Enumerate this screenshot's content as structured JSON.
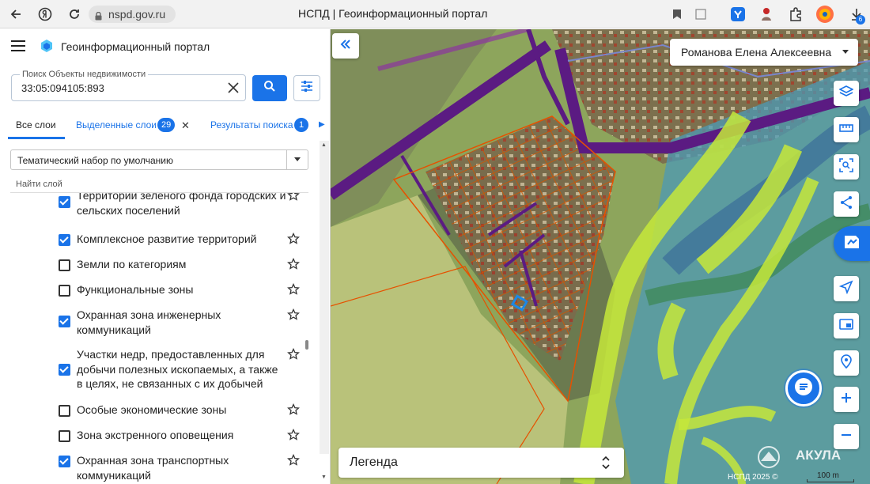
{
  "browser": {
    "url": "nspd.gov.ru",
    "page_title": "НСПД | Геоинформационный портал",
    "download_count": "6"
  },
  "app": {
    "title": "Геоинформационный портал"
  },
  "search": {
    "label": "Поиск Объекты недвижимости",
    "value": "33:05:094105:893"
  },
  "tabs": {
    "all": "Все слои",
    "selected": "Выделенные слои",
    "selected_count": "29",
    "results": "Результаты поиска",
    "results_count": "1"
  },
  "theme_select": {
    "value": "Тематический набор по умолчанию"
  },
  "find_layer": {
    "placeholder": "Найти слой"
  },
  "layers": [
    {
      "label": "Территории зеленого фонда городских и сельских поселений",
      "checked": true
    },
    {
      "label": "Комплексное развитие территорий",
      "checked": true
    },
    {
      "label": "Земли по категориям",
      "checked": false
    },
    {
      "label": "Функциональные зоны",
      "checked": false
    },
    {
      "label": "Охранная зона инженерных коммуникаций",
      "checked": true
    },
    {
      "label": "Участки недр, предоставленных для добычи полезных ископаемых, а также в целях, не связанных с их добычей",
      "checked": true
    },
    {
      "label": "Особые экономические зоны",
      "checked": false
    },
    {
      "label": "Зона экстренного оповещения",
      "checked": false
    },
    {
      "label": "Охранная зона транспортных коммуникаций",
      "checked": true
    }
  ],
  "map": {
    "user_name": "Романова Елена Алексеевна",
    "legend_label": "Легенда",
    "copyright": "НСПД 2025 ©",
    "scale_label": "100 m",
    "watermark": "АКУЛА"
  },
  "colors": {
    "accent": "#1a73e8",
    "purple_zone": "#6a1b9a",
    "green_zone": "#c6e83a",
    "river": "#5fb0c8"
  }
}
